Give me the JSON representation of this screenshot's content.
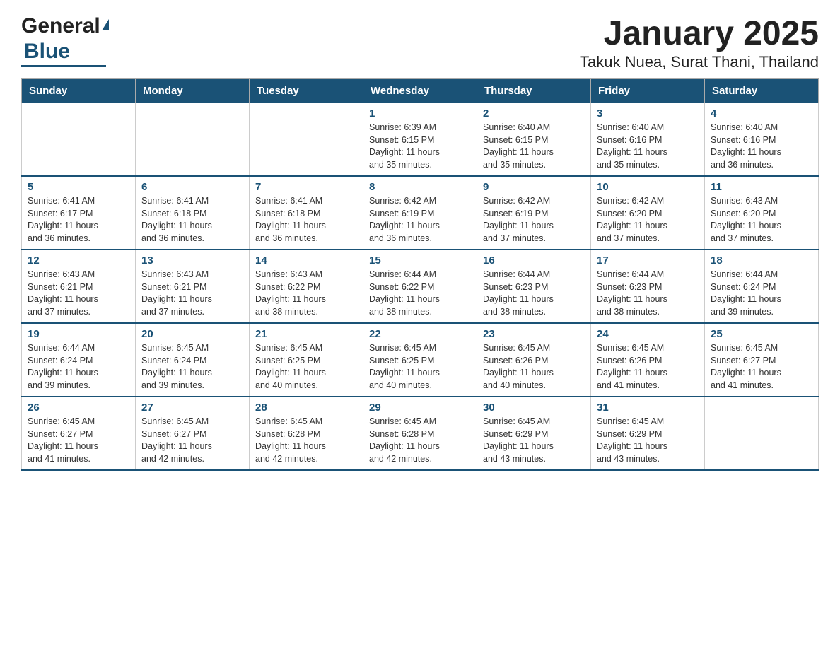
{
  "header": {
    "logo_general": "General",
    "logo_blue": "Blue",
    "title": "January 2025",
    "subtitle": "Takuk Nuea, Surat Thani, Thailand"
  },
  "days_of_week": [
    "Sunday",
    "Monday",
    "Tuesday",
    "Wednesday",
    "Thursday",
    "Friday",
    "Saturday"
  ],
  "weeks": [
    [
      {
        "day": "",
        "info": ""
      },
      {
        "day": "",
        "info": ""
      },
      {
        "day": "",
        "info": ""
      },
      {
        "day": "1",
        "info": "Sunrise: 6:39 AM\nSunset: 6:15 PM\nDaylight: 11 hours\nand 35 minutes."
      },
      {
        "day": "2",
        "info": "Sunrise: 6:40 AM\nSunset: 6:15 PM\nDaylight: 11 hours\nand 35 minutes."
      },
      {
        "day": "3",
        "info": "Sunrise: 6:40 AM\nSunset: 6:16 PM\nDaylight: 11 hours\nand 35 minutes."
      },
      {
        "day": "4",
        "info": "Sunrise: 6:40 AM\nSunset: 6:16 PM\nDaylight: 11 hours\nand 36 minutes."
      }
    ],
    [
      {
        "day": "5",
        "info": "Sunrise: 6:41 AM\nSunset: 6:17 PM\nDaylight: 11 hours\nand 36 minutes."
      },
      {
        "day": "6",
        "info": "Sunrise: 6:41 AM\nSunset: 6:18 PM\nDaylight: 11 hours\nand 36 minutes."
      },
      {
        "day": "7",
        "info": "Sunrise: 6:41 AM\nSunset: 6:18 PM\nDaylight: 11 hours\nand 36 minutes."
      },
      {
        "day": "8",
        "info": "Sunrise: 6:42 AM\nSunset: 6:19 PM\nDaylight: 11 hours\nand 36 minutes."
      },
      {
        "day": "9",
        "info": "Sunrise: 6:42 AM\nSunset: 6:19 PM\nDaylight: 11 hours\nand 37 minutes."
      },
      {
        "day": "10",
        "info": "Sunrise: 6:42 AM\nSunset: 6:20 PM\nDaylight: 11 hours\nand 37 minutes."
      },
      {
        "day": "11",
        "info": "Sunrise: 6:43 AM\nSunset: 6:20 PM\nDaylight: 11 hours\nand 37 minutes."
      }
    ],
    [
      {
        "day": "12",
        "info": "Sunrise: 6:43 AM\nSunset: 6:21 PM\nDaylight: 11 hours\nand 37 minutes."
      },
      {
        "day": "13",
        "info": "Sunrise: 6:43 AM\nSunset: 6:21 PM\nDaylight: 11 hours\nand 37 minutes."
      },
      {
        "day": "14",
        "info": "Sunrise: 6:43 AM\nSunset: 6:22 PM\nDaylight: 11 hours\nand 38 minutes."
      },
      {
        "day": "15",
        "info": "Sunrise: 6:44 AM\nSunset: 6:22 PM\nDaylight: 11 hours\nand 38 minutes."
      },
      {
        "day": "16",
        "info": "Sunrise: 6:44 AM\nSunset: 6:23 PM\nDaylight: 11 hours\nand 38 minutes."
      },
      {
        "day": "17",
        "info": "Sunrise: 6:44 AM\nSunset: 6:23 PM\nDaylight: 11 hours\nand 38 minutes."
      },
      {
        "day": "18",
        "info": "Sunrise: 6:44 AM\nSunset: 6:24 PM\nDaylight: 11 hours\nand 39 minutes."
      }
    ],
    [
      {
        "day": "19",
        "info": "Sunrise: 6:44 AM\nSunset: 6:24 PM\nDaylight: 11 hours\nand 39 minutes."
      },
      {
        "day": "20",
        "info": "Sunrise: 6:45 AM\nSunset: 6:24 PM\nDaylight: 11 hours\nand 39 minutes."
      },
      {
        "day": "21",
        "info": "Sunrise: 6:45 AM\nSunset: 6:25 PM\nDaylight: 11 hours\nand 40 minutes."
      },
      {
        "day": "22",
        "info": "Sunrise: 6:45 AM\nSunset: 6:25 PM\nDaylight: 11 hours\nand 40 minutes."
      },
      {
        "day": "23",
        "info": "Sunrise: 6:45 AM\nSunset: 6:26 PM\nDaylight: 11 hours\nand 40 minutes."
      },
      {
        "day": "24",
        "info": "Sunrise: 6:45 AM\nSunset: 6:26 PM\nDaylight: 11 hours\nand 41 minutes."
      },
      {
        "day": "25",
        "info": "Sunrise: 6:45 AM\nSunset: 6:27 PM\nDaylight: 11 hours\nand 41 minutes."
      }
    ],
    [
      {
        "day": "26",
        "info": "Sunrise: 6:45 AM\nSunset: 6:27 PM\nDaylight: 11 hours\nand 41 minutes."
      },
      {
        "day": "27",
        "info": "Sunrise: 6:45 AM\nSunset: 6:27 PM\nDaylight: 11 hours\nand 42 minutes."
      },
      {
        "day": "28",
        "info": "Sunrise: 6:45 AM\nSunset: 6:28 PM\nDaylight: 11 hours\nand 42 minutes."
      },
      {
        "day": "29",
        "info": "Sunrise: 6:45 AM\nSunset: 6:28 PM\nDaylight: 11 hours\nand 42 minutes."
      },
      {
        "day": "30",
        "info": "Sunrise: 6:45 AM\nSunset: 6:29 PM\nDaylight: 11 hours\nand 43 minutes."
      },
      {
        "day": "31",
        "info": "Sunrise: 6:45 AM\nSunset: 6:29 PM\nDaylight: 11 hours\nand 43 minutes."
      },
      {
        "day": "",
        "info": ""
      }
    ]
  ]
}
